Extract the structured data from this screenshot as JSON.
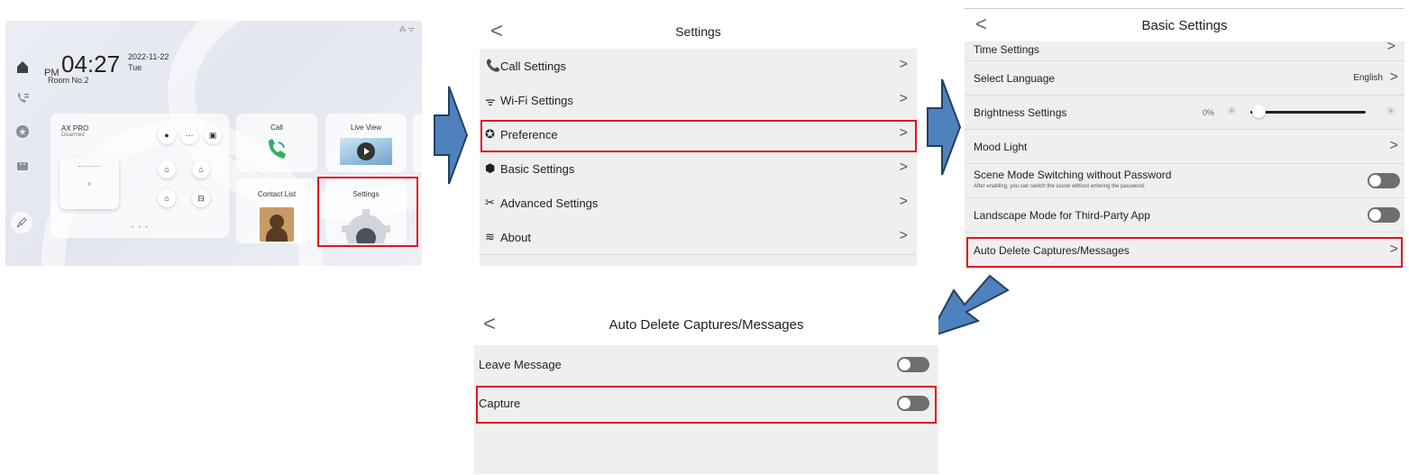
{
  "home": {
    "status_icons": "⁂ ᯤ",
    "ampm": "PM",
    "time": "04:27",
    "date": "2022-11-22",
    "weekday": "Tue",
    "room": "Room No.2",
    "alarm_card": {
      "title": "AX PRO",
      "status": "Disarmed"
    },
    "tiles": {
      "call": "Call",
      "live_view": "Live View",
      "contact_list": "Contact List",
      "settings": "Settings"
    },
    "icons": {
      "home_nav": "home-icon",
      "call_nav": "phone-list-icon",
      "pref_nav": "star-circle-icon",
      "message_nav": "message-icon",
      "clean_nav": "broom-icon"
    }
  },
  "settings": {
    "title": "Settings",
    "back": "<",
    "items": [
      {
        "icon": "📞",
        "label": "Call Settings",
        "chevron": ">"
      },
      {
        "icon": "ᯤ",
        "label": "Wi-Fi Settings",
        "chevron": ">"
      },
      {
        "icon": "✪",
        "label": "Preference",
        "chevron": ">"
      },
      {
        "icon": "⬢",
        "label": "Basic Settings",
        "chevron": ">"
      },
      {
        "icon": "✂",
        "label": "Advanced Settings",
        "chevron": ">"
      },
      {
        "icon": "≋",
        "label": "About",
        "chevron": ">"
      }
    ]
  },
  "basic": {
    "title": "Basic Settings",
    "back": "<",
    "partial_item": "Time Settings",
    "language_label": "Select Language",
    "language_value": "English",
    "brightness_label": "Brightness Settings",
    "brightness_value": "0%",
    "brightness_level": 0,
    "mood_label": "Mood Light",
    "scene_label": "Scene Mode Switching without Password",
    "scene_desc": "After enabling, you can switch the scene without entering the password.",
    "landscape_label": "Landscape Mode for Third-Party App",
    "autodelete_label": "Auto Delete Captures/Messages",
    "chevron": ">"
  },
  "autodelete": {
    "title": "Auto Delete Captures/Messages",
    "back": "<",
    "items": [
      {
        "label": "Leave Message",
        "enabled": false
      },
      {
        "label": "Capture",
        "enabled": false
      }
    ]
  },
  "colors": {
    "highlight": "#e0151f",
    "arrow_fill": "#4f81bd",
    "arrow_stroke": "#243f60",
    "toggle_off": "#6e6e6e"
  }
}
